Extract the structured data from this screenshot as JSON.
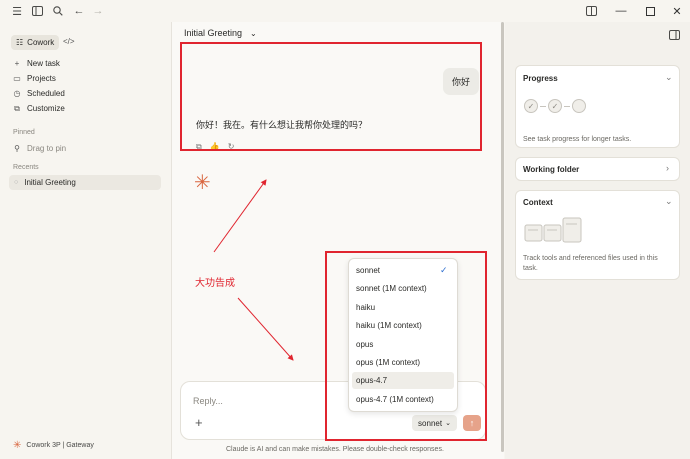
{
  "titlebar": {
    "icons": [
      "menu-icon",
      "sidebar-toggle-icon",
      "search-icon",
      "back-arrow-icon",
      "forward-arrow-icon"
    ],
    "window_controls": [
      "minimize",
      "maximize",
      "close"
    ]
  },
  "sidebar": {
    "mode_label": "Cowork",
    "nav_items": [
      {
        "label": "New task",
        "icon": "plus-icon"
      },
      {
        "label": "Projects",
        "icon": "folder-icon"
      },
      {
        "label": "Scheduled",
        "icon": "clock-icon"
      },
      {
        "label": "Customize",
        "icon": "customize-icon"
      }
    ],
    "pinned_label": "Pinned",
    "pinned_hint": "Drag to pin",
    "recents_label": "Recents",
    "recent_items": [
      {
        "label": "Initial Greeting"
      }
    ],
    "footer_label": "Cowork 3P | Gateway"
  },
  "conversation": {
    "title": "Initial Greeting",
    "user_message": "你好",
    "assistant_message": "你好！我在。有什么想让我帮你处理的吗？",
    "reply_placeholder": "Reply...",
    "model_chip_label": "sonnet",
    "disclaimer": "Claude is AI and can make mistakes. Please double-check responses."
  },
  "model_dropdown": {
    "selected": "sonnet",
    "highlighted": "opus-4.7",
    "options": [
      "sonnet",
      "sonnet (1M context)",
      "haiku",
      "haiku (1M context)",
      "opus",
      "opus (1M context)",
      "opus-4.7",
      "opus-4.7 (1M context)"
    ]
  },
  "right_panel": {
    "progress": {
      "title": "Progress",
      "subtitle": "See task progress for longer tasks."
    },
    "working_folder": {
      "title": "Working folder"
    },
    "context": {
      "title": "Context",
      "subtitle": "Track tools and referenced files used in this task."
    }
  },
  "annotation": {
    "label": "大功告成",
    "color": "#e0252f"
  },
  "colors": {
    "accent": "#d9663f",
    "send_button": "#e6a38a",
    "check": "#2f6fd0"
  }
}
